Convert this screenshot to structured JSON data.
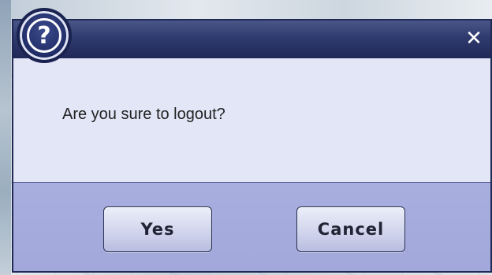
{
  "dialog": {
    "close_glyph": "✕",
    "message": "Are you sure to logout?",
    "icon_glyph": "?",
    "buttons": {
      "yes_label": "Yes",
      "cancel_label": "Cancel"
    }
  }
}
